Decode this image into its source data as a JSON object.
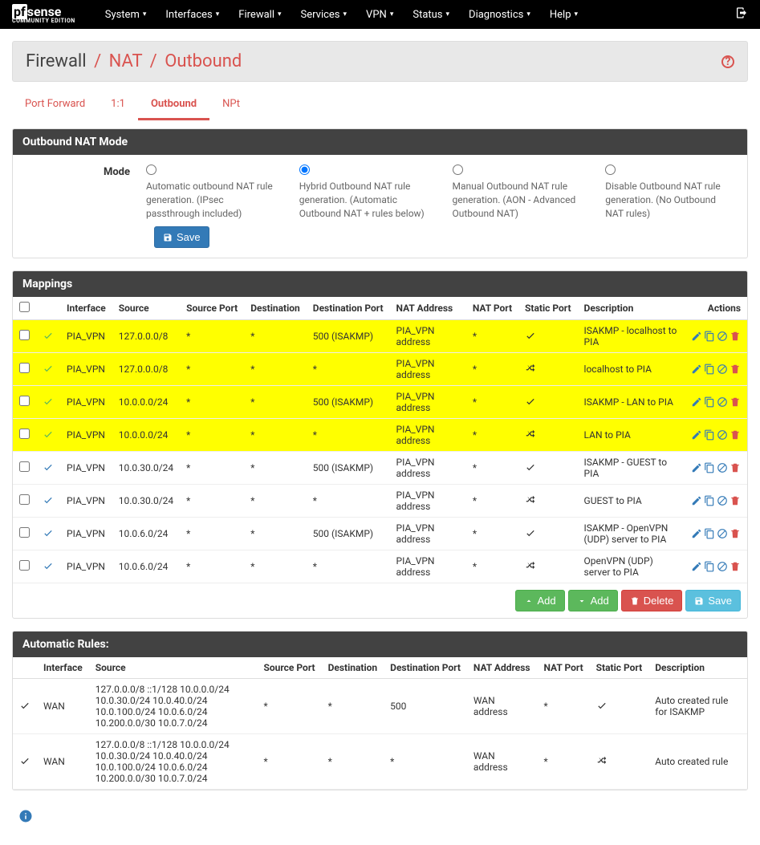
{
  "nav": {
    "logo_main_pf": "pf",
    "logo_main_sense": "sense",
    "logo_sub": "COMMUNITY EDITION",
    "items": [
      "System",
      "Interfaces",
      "Firewall",
      "Services",
      "VPN",
      "Status",
      "Diagnostics",
      "Help"
    ]
  },
  "breadcrumb": {
    "a": "Firewall",
    "b": "NAT",
    "c": "Outbound"
  },
  "tabs": [
    "Port Forward",
    "1:1",
    "Outbound",
    "NPt"
  ],
  "active_tab": "Outbound",
  "mode": {
    "label": "Mode",
    "options": [
      "Automatic outbound NAT rule generation.\n(IPsec passthrough included)",
      "Hybrid Outbound NAT rule generation.\n(Automatic Outbound NAT + rules below)",
      "Manual Outbound NAT rule generation.\n(AON - Advanced Outbound NAT)",
      "Disable Outbound NAT rule generation.\n(No Outbound NAT rules)"
    ],
    "selected": 1,
    "save": "Save"
  },
  "panels": {
    "nat_mode": "Outbound NAT Mode",
    "mappings": "Mappings",
    "auto": "Automatic Rules:"
  },
  "columns": [
    "Interface",
    "Source",
    "Source Port",
    "Destination",
    "Destination Port",
    "NAT Address",
    "NAT Port",
    "Static Port",
    "Description",
    "Actions"
  ],
  "rows": [
    {
      "hl": true,
      "anchor": true,
      "if": "PIA_VPN",
      "src": "127.0.0.0/8",
      "sp": "*",
      "dst": "*",
      "dp": "500 (ISAKMP)",
      "nat": "PIA_VPN address",
      "np": "*",
      "static": "check",
      "desc": "ISAKMP - localhost to PIA"
    },
    {
      "hl": true,
      "anchor": true,
      "if": "PIA_VPN",
      "src": "127.0.0.0/8",
      "sp": "*",
      "dst": "*",
      "dp": "*",
      "nat": "PIA_VPN address",
      "np": "*",
      "static": "random",
      "desc": "localhost to PIA"
    },
    {
      "hl": true,
      "anchor": true,
      "if": "PIA_VPN",
      "src": "10.0.0.0/24",
      "sp": "*",
      "dst": "*",
      "dp": "500 (ISAKMP)",
      "nat": "PIA_VPN address",
      "np": "*",
      "static": "check",
      "desc": "ISAKMP - LAN to PIA"
    },
    {
      "hl": true,
      "anchor": true,
      "if": "PIA_VPN",
      "src": "10.0.0.0/24",
      "sp": "*",
      "dst": "*",
      "dp": "*",
      "nat": "PIA_VPN address",
      "np": "*",
      "static": "random",
      "desc": "LAN to PIA"
    },
    {
      "hl": false,
      "anchor": false,
      "if": "PIA_VPN",
      "src": "10.0.30.0/24",
      "sp": "*",
      "dst": "*",
      "dp": "500 (ISAKMP)",
      "nat": "PIA_VPN address",
      "np": "*",
      "static": "check",
      "desc": "ISAKMP - GUEST to PIA"
    },
    {
      "hl": false,
      "anchor": false,
      "if": "PIA_VPN",
      "src": "10.0.30.0/24",
      "sp": "*",
      "dst": "*",
      "dp": "*",
      "nat": "PIA_VPN address",
      "np": "*",
      "static": "random",
      "desc": "GUEST to PIA"
    },
    {
      "hl": false,
      "anchor": false,
      "if": "PIA_VPN",
      "src": "10.0.6.0/24",
      "sp": "*",
      "dst": "*",
      "dp": "500 (ISAKMP)",
      "nat": "PIA_VPN address",
      "np": "*",
      "static": "check",
      "desc": "ISAKMP - OpenVPN (UDP) server to PIA"
    },
    {
      "hl": false,
      "anchor": false,
      "if": "PIA_VPN",
      "src": "10.0.6.0/24",
      "sp": "*",
      "dst": "*",
      "dp": "*",
      "nat": "PIA_VPN address",
      "np": "*",
      "static": "random",
      "desc": "OpenVPN (UDP) server to PIA"
    }
  ],
  "buttons": {
    "add": "Add",
    "delete": "Delete",
    "save": "Save"
  },
  "auto_columns": [
    "Interface",
    "Source",
    "Source Port",
    "Destination",
    "Destination Port",
    "NAT Address",
    "NAT Port",
    "Static Port",
    "Description"
  ],
  "auto_rows": [
    {
      "if": "WAN",
      "src": "127.0.0.0/8 ::1/128 10.0.0.0/24 10.0.30.0/24 10.0.40.0/24 10.0.100.0/24 10.0.6.0/24 10.200.0.0/30 10.0.7.0/24",
      "sp": "*",
      "dst": "*",
      "dp": "500",
      "nat": "WAN address",
      "np": "*",
      "static": "check",
      "desc": "Auto created rule for ISAKMP"
    },
    {
      "if": "WAN",
      "src": "127.0.0.0/8 ::1/128 10.0.0.0/24 10.0.30.0/24 10.0.40.0/24 10.0.100.0/24 10.0.6.0/24 10.200.0.0/30 10.0.7.0/24",
      "sp": "*",
      "dst": "*",
      "dp": "*",
      "nat": "WAN address",
      "np": "*",
      "static": "random",
      "desc": "Auto created rule"
    }
  ]
}
